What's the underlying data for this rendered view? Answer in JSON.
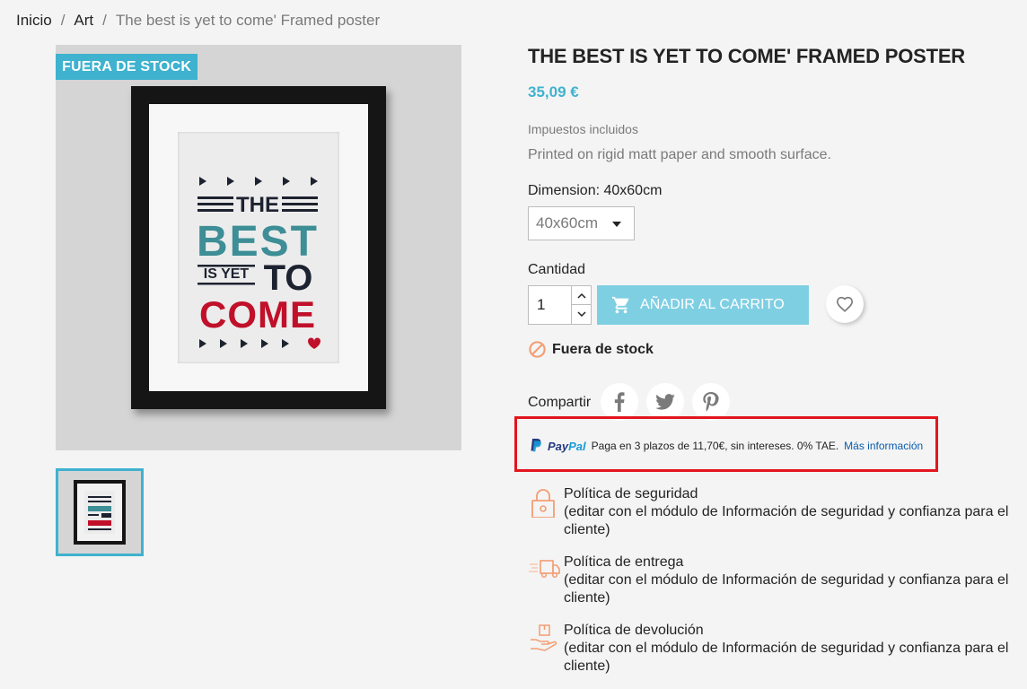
{
  "breadcrumb": {
    "items": [
      "Inicio",
      "Art"
    ],
    "current": "The best is yet to come' Framed poster",
    "separator": "/"
  },
  "product": {
    "flag": "FUERA DE STOCK",
    "title": "THE BEST IS YET TO COME' FRAMED POSTER",
    "price": "35,09 €",
    "tax_note": "Impuestos incluidos",
    "description": "Printed on rigid matt paper and smooth surface.",
    "dimension_label": "Dimension: 40x60cm",
    "dimension_value": "40x60cm",
    "quantity_label": "Cantidad",
    "quantity": "1",
    "add_to_cart": "AÑADIR AL CARRITO",
    "availability": "Fuera de stock",
    "share_label": "Compartir",
    "poster_text": {
      "line1": "THE",
      "line2": "BEST",
      "line3a": "IS YET",
      "line3b": "TO",
      "line4": "COME"
    }
  },
  "paypal": {
    "logo_pay": "Pay",
    "logo_pal": "Pal",
    "message": "Paga en 3 plazos de 11,70€, sin intereses. 0% TAE.",
    "link": "Más información"
  },
  "reassurance": [
    {
      "title": "Política de seguridad",
      "text": "(editar con el módulo de Información de seguridad y confianza para el cliente)"
    },
    {
      "title": "Política de entrega",
      "text": "(editar con el módulo de Información de seguridad y confianza para el cliente)"
    },
    {
      "title": "Política de devolución",
      "text": "(editar con el módulo de Información de seguridad y confianza para el cliente)"
    }
  ],
  "colors": {
    "accent": "#3fb2cf",
    "cart_button": "#7fcfe3",
    "paypal_border": "#e3151e",
    "out_of_stock_icon": "#f39d72",
    "poster_teal": "#3d8e96",
    "poster_red": "#c0102a",
    "poster_dark": "#1d2230"
  }
}
